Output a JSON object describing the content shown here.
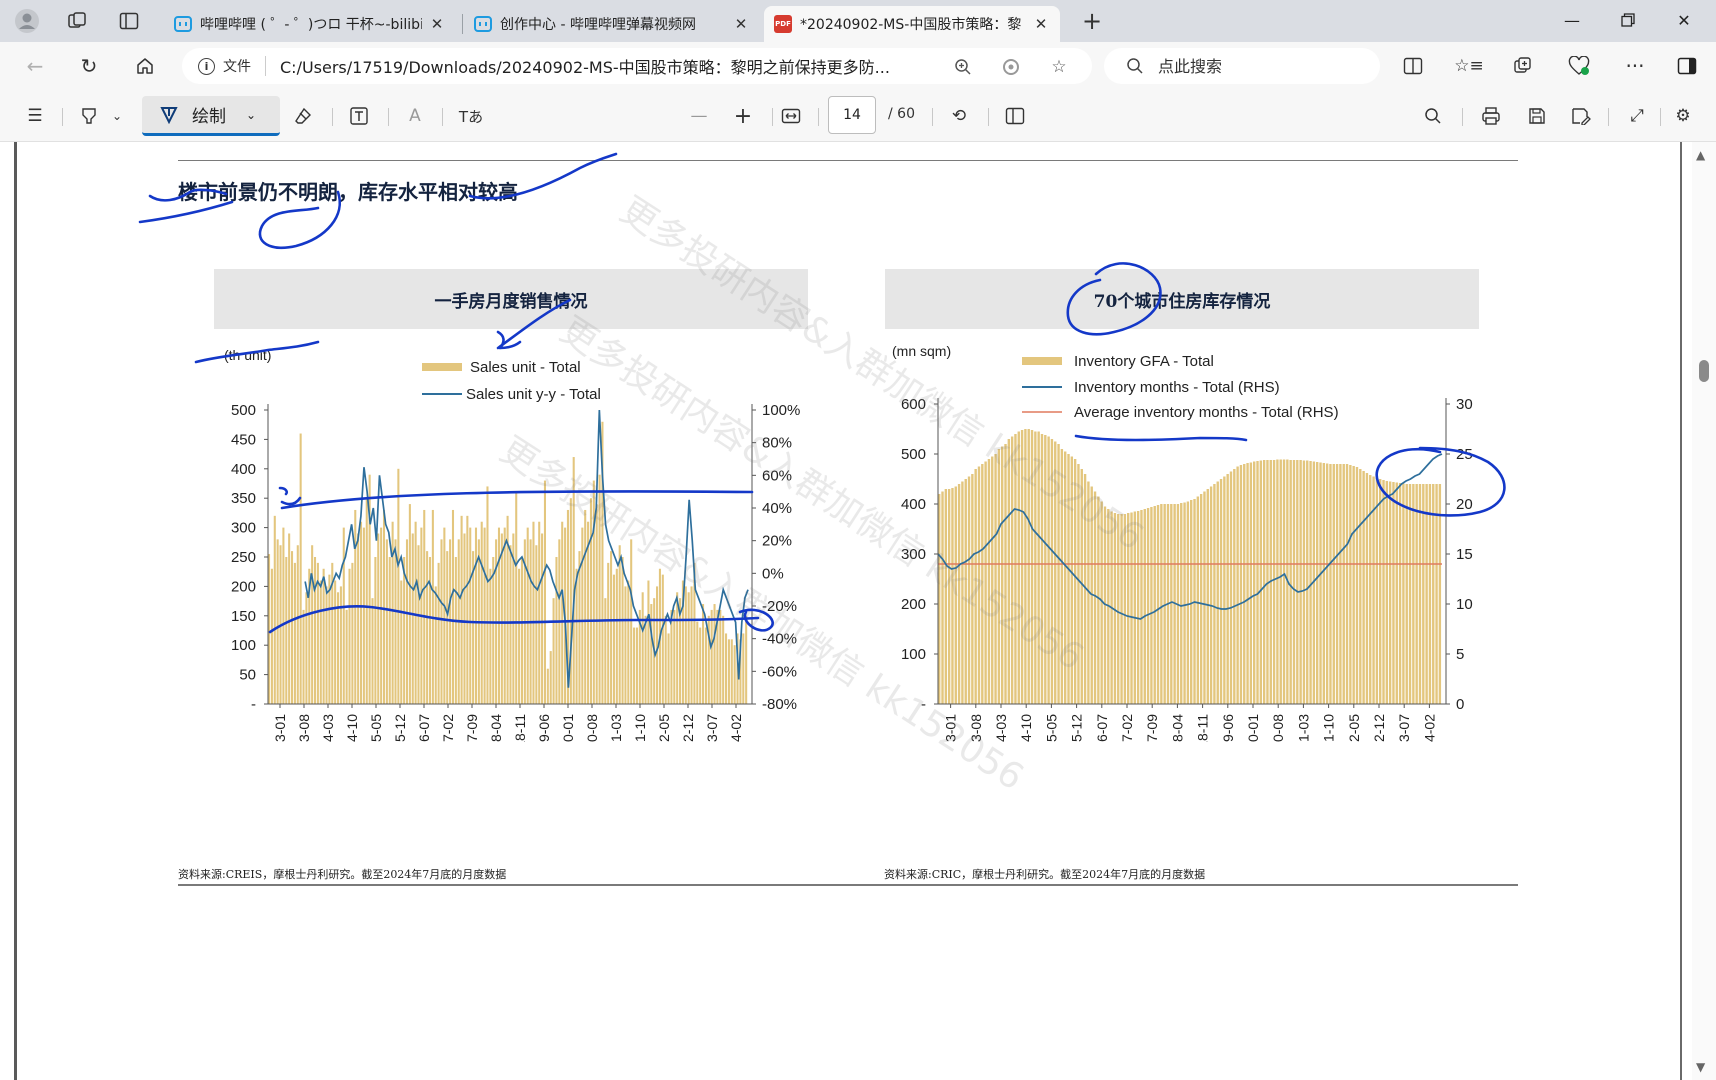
{
  "browser": {
    "tabs": [
      {
        "title": "哔哩哔哩 ( ゜- ゜)つロ 干杯~-bilibili",
        "icon": "bilibili-icon"
      },
      {
        "title": "创作中心 - 哔哩哔哩弹幕视频网",
        "icon": "bilibili-icon"
      },
      {
        "title": "*20240902-MS-中国股市策略：黎",
        "icon": "pdf-icon",
        "active": true
      }
    ],
    "address": {
      "info_label": "文件",
      "url": "C:/Users/17519/Downloads/20240902-MS-中国股市策略：黎明之前保持更多防...",
      "search_placeholder": "点此搜索"
    }
  },
  "pdf_toolbar": {
    "draw_label": "绘制",
    "read_aloud_label": "A",
    "immersive_label": "Tあ",
    "current_page": "14",
    "total_pages": "/ 60"
  },
  "document": {
    "heading": "楼市前景仍不明朗，库存水平相对较高",
    "left_panel_title": "一手房月度销售情况",
    "right_panel_title": "70个城市住房库存情况",
    "left_source": "资料来源:CREIS，摩根士丹利研究。截至2024年7月底的月度数据",
    "right_source": "资料来源:CRIC，摩根士丹利研究。截至2024年7月底的月度数据",
    "watermark": "更多投研内容&入群加微信 kk152056"
  },
  "chart_data": [
    {
      "type": "bar",
      "unit_label": "(th unit)",
      "legend": [
        "Sales unit - Total",
        "Sales unit y-y - Total"
      ],
      "x_ticks": [
        "2013-01",
        "2013-08",
        "2014-03",
        "2014-10",
        "2015-05",
        "2015-12",
        "2016-07",
        "2017-02",
        "2017-09",
        "2018-04",
        "2018-11",
        "2019-06",
        "2020-01",
        "2020-08",
        "2021-03",
        "2021-10",
        "2022-05",
        "2022-12",
        "2023-07",
        "2024-02"
      ],
      "left_axis": {
        "ticks": [
          "-",
          "50",
          "100",
          "150",
          "200",
          "250",
          "300",
          "350",
          "400",
          "450",
          "500"
        ],
        "range": [
          0,
          500
        ]
      },
      "right_axis": {
        "ticks": [
          "-80%",
          "-60%",
          "-40%",
          "-20%",
          "0%",
          "20%",
          "40%",
          "60%",
          "80%",
          "100%"
        ],
        "range": [
          -80,
          100
        ]
      },
      "sales_unit": [
        255,
        230,
        320,
        280,
        270,
        300,
        250,
        290,
        260,
        240,
        270,
        460,
        160,
        190,
        230,
        270,
        250,
        240,
        210,
        230,
        200,
        220,
        240,
        210,
        190,
        200,
        300,
        160,
        230,
        240,
        330,
        290,
        310,
        300,
        350,
        390,
        180,
        250,
        290,
        300,
        330,
        280,
        250,
        310,
        280,
        400,
        210,
        250,
        280,
        340,
        290,
        310,
        270,
        300,
        330,
        260,
        250,
        330,
        200,
        240,
        280,
        300,
        260,
        280,
        330,
        250,
        280,
        320,
        290,
        320,
        300,
        260,
        300,
        280,
        310,
        300,
        370,
        230,
        250,
        280,
        300,
        290,
        300,
        320,
        270,
        290,
        360,
        230,
        250,
        280,
        300,
        280,
        310,
        270,
        310,
        290,
        380,
        60,
        90,
        180,
        250,
        280,
        310,
        300,
        330,
        350,
        420,
        230,
        260,
        300,
        330,
        310,
        350,
        380,
        340,
        390,
        480,
        180,
        240,
        260,
        220,
        230,
        270,
        250,
        200,
        210,
        280,
        130,
        130,
        160,
        190,
        150,
        210,
        170,
        180,
        200,
        230,
        220,
        150,
        120,
        160,
        160,
        190,
        180,
        210,
        200,
        190,
        200,
        240,
        140,
        130,
        170,
        130,
        150,
        160,
        170,
        160,
        160,
        150,
        120,
        110,
        110,
        100,
        120,
        110,
        120,
        150
      ],
      "sales_yoy": [
        null,
        null,
        null,
        null,
        null,
        null,
        null,
        null,
        null,
        null,
        null,
        null,
        -5,
        -15,
        0,
        -10,
        -5,
        -8,
        -2,
        -12,
        -10,
        -5,
        0,
        -3,
        5,
        10,
        20,
        30,
        15,
        20,
        35,
        65,
        50,
        30,
        40,
        20,
        60,
        45,
        30,
        25,
        10,
        15,
        5,
        10,
        0,
        -5,
        -8,
        -10,
        -5,
        -15,
        -10,
        -8,
        -5,
        -10,
        -12,
        -15,
        -18,
        -20,
        -25,
        -15,
        -10,
        -12,
        -15,
        -10,
        -8,
        -5,
        0,
        5,
        10,
        5,
        0,
        -5,
        -3,
        0,
        5,
        10,
        15,
        20,
        15,
        10,
        5,
        8,
        10,
        5,
        0,
        -5,
        -8,
        -10,
        -5,
        0,
        5,
        2,
        -5,
        -10,
        -15,
        -10,
        -30,
        -70,
        -40,
        -10,
        0,
        5,
        10,
        15,
        20,
        25,
        40,
        100,
        60,
        30,
        20,
        15,
        10,
        5,
        10,
        0,
        -5,
        -10,
        -20,
        -25,
        -30,
        -35,
        -30,
        -25,
        -40,
        -50,
        -45,
        -35,
        -30,
        -25,
        -30,
        -20,
        -15,
        -25,
        -20,
        10,
        45,
        20,
        -10,
        -15,
        -20,
        -25,
        -35,
        -45,
        -40,
        -30,
        -20,
        -10,
        -15,
        -20,
        -25,
        -30,
        -65,
        -30,
        -15,
        -10
      ]
    },
    {
      "type": "bar",
      "unit_label": "(mn sqm)",
      "legend": [
        "Inventory GFA - Total",
        "Inventory months - Total (RHS)",
        "Average inventory months - Total (RHS)"
      ],
      "x_ticks": [
        "2013-01",
        "2013-08",
        "2014-03",
        "2014-10",
        "2015-05",
        "2015-12",
        "2016-07",
        "2017-02",
        "2017-09",
        "2018-04",
        "2018-11",
        "2019-06",
        "2020-01",
        "2020-08",
        "2021-03",
        "2021-10",
        "2022-05",
        "2022-12",
        "2023-07",
        "2024-02"
      ],
      "left_axis": {
        "ticks": [
          "-",
          "100",
          "200",
          "300",
          "400",
          "500",
          "600"
        ],
        "range": [
          0,
          600
        ]
      },
      "right_axis": {
        "ticks": [
          "0",
          "5",
          "10",
          "15",
          "20",
          "25",
          "30"
        ],
        "range": [
          0,
          30
        ]
      },
      "average_inventory_months": 14,
      "inventory_gfa": [
        420,
        425,
        430,
        430,
        432,
        435,
        440,
        445,
        450,
        455,
        460,
        470,
        475,
        480,
        485,
        490,
        495,
        500,
        510,
        515,
        520,
        530,
        535,
        540,
        545,
        548,
        550,
        550,
        548,
        545,
        545,
        540,
        538,
        535,
        530,
        525,
        520,
        510,
        505,
        500,
        495,
        490,
        480,
        470,
        460,
        445,
        435,
        425,
        415,
        405,
        395,
        390,
        385,
        382,
        380,
        380,
        380,
        382,
        383,
        385,
        386,
        388,
        390,
        392,
        394,
        396,
        398,
        400,
        400,
        400,
        400,
        400,
        400,
        402,
        403,
        405,
        408,
        410,
        415,
        420,
        425,
        430,
        435,
        440,
        445,
        450,
        455,
        460,
        465,
        470,
        475,
        478,
        480,
        482,
        483,
        485,
        486,
        487,
        488,
        488,
        488,
        488,
        489,
        489,
        489,
        489,
        488,
        488,
        488,
        488,
        487,
        487,
        486,
        485,
        484,
        483,
        482,
        481,
        480,
        480,
        480,
        480,
        480,
        480,
        478,
        476,
        474,
        470,
        466,
        462,
        458,
        455,
        452,
        450,
        448,
        446,
        445,
        444,
        443,
        442,
        441,
        440,
        440,
        440,
        440,
        440,
        440,
        440,
        440,
        440,
        440,
        440
      ],
      "inventory_months": [
        15,
        14.5,
        13.8,
        13.5,
        13.6,
        14,
        14.2,
        14.5,
        15,
        15.2,
        15.5,
        16,
        16.5,
        17,
        18,
        18.5,
        19,
        19.5,
        19.4,
        19.2,
        18.5,
        17.5,
        17,
        16.5,
        16,
        15.5,
        15,
        14.5,
        14,
        13.5,
        13,
        12.5,
        12,
        11.5,
        11,
        10.8,
        10.5,
        10,
        9.8,
        9.5,
        9.2,
        9,
        8.8,
        8.7,
        8.6,
        8.5,
        8.8,
        9,
        9.2,
        9.5,
        9.8,
        10,
        10.2,
        10,
        9.8,
        9.9,
        10,
        10.2,
        10.1,
        10,
        9.9,
        9.8,
        9.6,
        9.5,
        9.5,
        9.6,
        9.8,
        10,
        10.2,
        10.5,
        10.8,
        11,
        11.5,
        12,
        12.3,
        12.5,
        12.7,
        13,
        12,
        11.5,
        11.2,
        11.3,
        11.5,
        12,
        12.5,
        13,
        13.5,
        14,
        14.5,
        15,
        15.5,
        16,
        17,
        17.5,
        18,
        18.5,
        19,
        19.5,
        20,
        20.5,
        20.8,
        21,
        21.5,
        22,
        22.3,
        22.5,
        22.8,
        23,
        23.5,
        24,
        24.5,
        24.8,
        25
      ]
    }
  ]
}
